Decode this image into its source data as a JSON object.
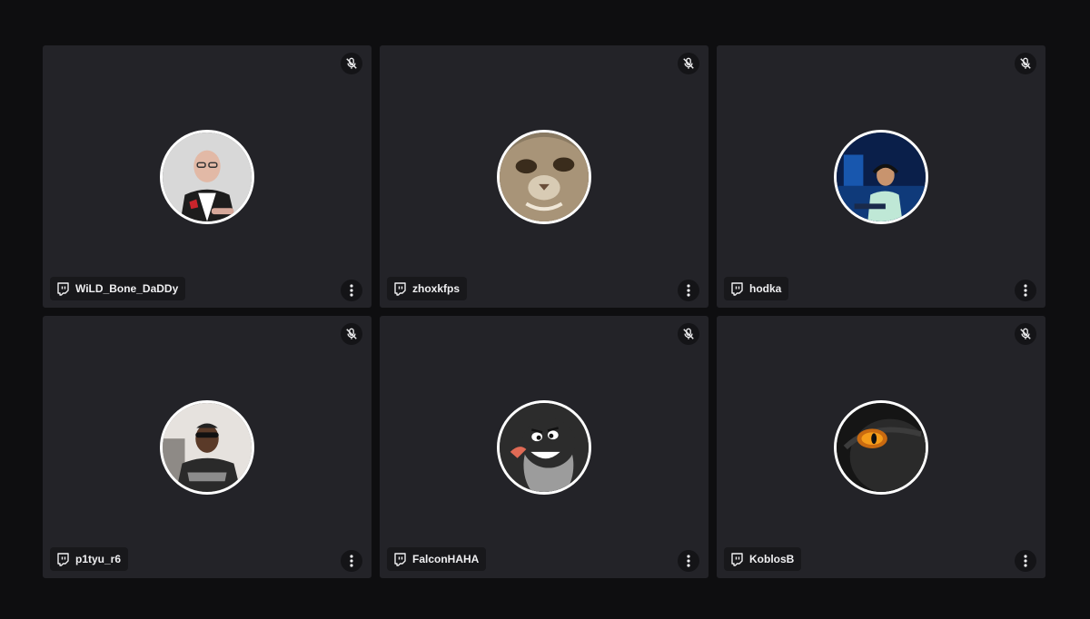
{
  "participants": [
    {
      "name": "WiLD_Bone_DaDDy",
      "platform_icon": "twitch-icon",
      "muted": true,
      "avatar": "man-glasses-jersey"
    },
    {
      "name": "zhoxkfps",
      "platform_icon": "twitch-icon",
      "muted": true,
      "avatar": "cat-closeup"
    },
    {
      "name": "hodka",
      "platform_icon": "twitch-icon",
      "muted": true,
      "avatar": "gamer-headset-blue-light"
    },
    {
      "name": "p1tyu_r6",
      "platform_icon": "twitch-icon",
      "muted": true,
      "avatar": "man-sunglasses"
    },
    {
      "name": "FalconHAHA",
      "platform_icon": "twitch-icon",
      "muted": true,
      "avatar": "cartoon-mole"
    },
    {
      "name": "KoblosB",
      "platform_icon": "twitch-icon",
      "muted": true,
      "avatar": "black-panther-eye"
    }
  ],
  "colors": {
    "background": "#0e0e10",
    "tile": "#232328",
    "tag": "#18181b",
    "text": "#efeff1"
  }
}
